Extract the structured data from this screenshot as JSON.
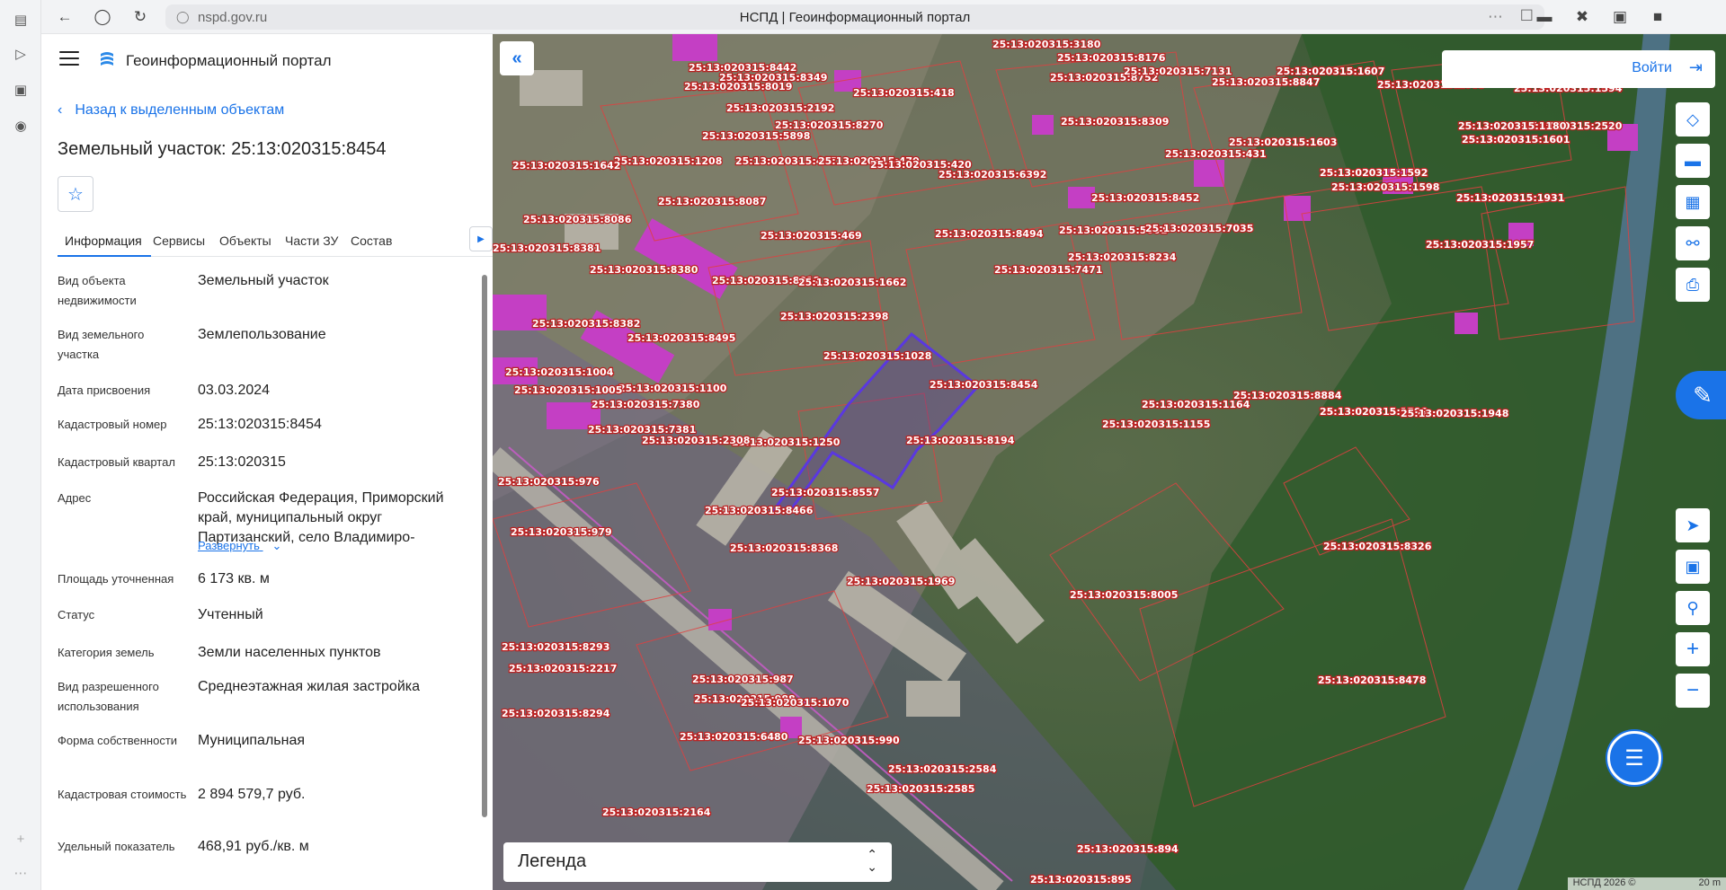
{
  "browser": {
    "url": "nspd.gov.ru",
    "title": "НСПД | Геоинформационный портал"
  },
  "header": {
    "portal_name": "Геоинформационный портал"
  },
  "panel": {
    "back_link": "Назад к выделенным объектам",
    "title": "Земельный участок: 25:13:020315:8454",
    "tabs": [
      {
        "label": "Информация"
      },
      {
        "label": "Сервисы"
      },
      {
        "label": "Объекты"
      },
      {
        "label": "Части ЗУ"
      },
      {
        "label": "Состав"
      }
    ],
    "properties": [
      {
        "label": "Вид объекта недвижимости",
        "value": "Земельный участок"
      },
      {
        "label": "Вид земельного участка",
        "value": "Землепользование"
      },
      {
        "label": "Дата присвоения",
        "value": "03.03.2024"
      },
      {
        "label": "Кадастровый номер",
        "value": "25:13:020315:8454"
      },
      {
        "label": "Кадастровый квартал",
        "value": "25:13:020315"
      },
      {
        "label": "Адрес",
        "value": "Российская Федерация, Приморский край, муниципальный округ Партизанский, село Владимиро-"
      },
      {
        "label": "Площадь уточненная",
        "value": "6 173 кв. м"
      },
      {
        "label": "Статус",
        "value": "Учтенный"
      },
      {
        "label": "Категория земель",
        "value": "Земли населенных пунктов"
      },
      {
        "label": "Вид разрешенного использования",
        "value": "Среднеэтажная жилая застройка"
      },
      {
        "label": "Форма собственности",
        "value": "Муниципальная"
      },
      {
        "label": "Кадастровая стоимость",
        "value": "2 894 579,7 руб."
      },
      {
        "label": "Удельный показатель",
        "value": "468,91 руб./кв. м"
      }
    ],
    "expand_label": "Развернуть"
  },
  "map": {
    "login_label": "Войти",
    "legend_label": "Легенда",
    "copyright": "НСПД 2026 ©",
    "scale": "20 m",
    "labels": [
      "25:13:020315:8442",
      "25:13:020315:8349",
      "25:13:020315:8019",
      "25:13:020315:418",
      "25:13:020315:8752",
      "25:13:020315:7131",
      "25:13:020315:8847",
      "25:13:020315:1607",
      "25:13:020315:1609",
      "25:13:020315:1594",
      "25:13:020315:2192",
      "25:13:020315:8270",
      "25:13:020315:5898",
      "25:13:020315:1208",
      "25:13:020315:467",
      "25:13:020315:470",
      "25:13:020315:420",
      "25:13:020315:6392",
      "25:13:020315:8452",
      "25:13:020315:1603",
      "25:13:020315:2520",
      "25:13:020315:1642",
      "25:13:020315:8087",
      "25:13:020315:8086",
      "25:13:020315:469",
      "25:13:020315:8494",
      "25:13:020315:5601",
      "25:13:020315:7035",
      "25:13:020315:1592",
      "25:13:020315:1598",
      "25:13:020315:1931",
      "25:13:020315:1957",
      "25:13:020315:8381",
      "25:13:020315:8380",
      "25:13:020315:8012",
      "25:13:020315:1662",
      "25:13:020315:7471",
      "25:13:020315:8234",
      "25:13:020315:2398",
      "25:13:020315:8382",
      "25:13:020315:8495",
      "25:13:020315:1028",
      "25:13:020315:8454",
      "25:13:020315:8884",
      "25:13:020315:1164",
      "25:13:020315:1004",
      "25:13:020315:1100",
      "25:13:020315:1005",
      "25:13:020315:7380",
      "25:13:020315:7381",
      "25:13:020315:1250",
      "25:13:020315:2308",
      "25:13:020315:8194",
      "25:13:020315:1155",
      "25:13:020315:1599",
      "25:13:020315:1948",
      "25:13:020315:976",
      "25:13:020315:8557",
      "25:13:020315:8466",
      "25:13:020315:979",
      "25:13:020315:8368",
      "25:13:020315:1969",
      "25:13:020315:8005",
      "25:13:020315:8326",
      "25:13:020315:8293",
      "25:13:020315:2217",
      "25:13:020315:987",
      "25:13:020315:8294",
      "25:13:020315:988",
      "25:13:020315:1070",
      "25:13:020315:6480",
      "25:13:020315:990",
      "25:13:020315:2584",
      "25:13:020315:2585",
      "25:13:020315:2164",
      "25:13:020315:8478",
      "25:13:020315:894",
      "25:13:020315:895",
      "25:13:020315:3180",
      "25:13:020315:8176",
      "25:13:020315:1180",
      "25:13:020315:1601",
      "25:13:020315:431",
      "25:13:020315:8309"
    ]
  }
}
